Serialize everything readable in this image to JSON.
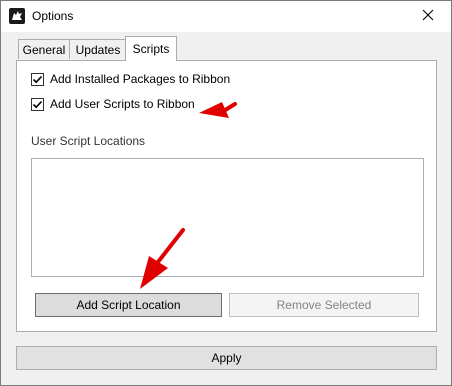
{
  "window": {
    "title": "Options",
    "app_icon": "rhino-icon",
    "close_icon": "close-icon"
  },
  "tabs": [
    {
      "label": "General",
      "active": false
    },
    {
      "label": "Updates",
      "active": false
    },
    {
      "label": "Scripts",
      "active": true
    }
  ],
  "scripts_tab": {
    "checkboxes": [
      {
        "label": "Add Installed Packages to Ribbon",
        "checked": true
      },
      {
        "label": "Add User Scripts to Ribbon",
        "checked": true
      }
    ],
    "locations_label": "User Script Locations",
    "locations": [],
    "add_button": "Add Script Location",
    "remove_button": "Remove Selected",
    "remove_enabled": false
  },
  "footer": {
    "apply_button": "Apply"
  },
  "colors": {
    "annotation_arrow": "#e00000"
  }
}
